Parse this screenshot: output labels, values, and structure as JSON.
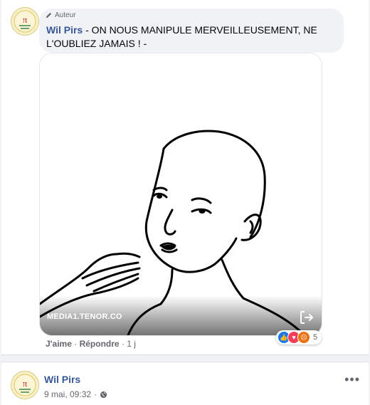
{
  "comment": {
    "badge_label": "Auteur",
    "author": "Wil Pirs",
    "text": " - ON NOUS MANIPULE MERVEILLEUSEMENT, NE L'OUBLIEZ JAMAIS ! -",
    "gif_source": "MEDIA1.TENOR.CO",
    "like_label": "J'aime",
    "reply_label": "Répondre",
    "time": "1 j",
    "separator": "·",
    "reaction_count": "5",
    "reactions": [
      "like-icon",
      "love-icon",
      "angry-icon"
    ]
  },
  "post": {
    "author": "Wil Pirs",
    "date": "9 mai, 09:32",
    "separator": "·",
    "privacy_icon": "globe-icon"
  },
  "colors": {
    "link": "#385898",
    "like": "#1877f2",
    "love": "#f33e58",
    "angry": "#e9710f"
  }
}
